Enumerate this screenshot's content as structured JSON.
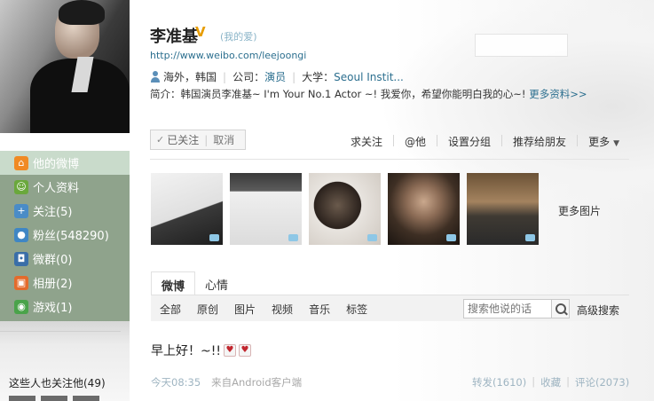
{
  "profile": {
    "name": "李准基",
    "remark": "(我的爱)",
    "url": "http://www.weibo.com/leejoongi",
    "location": "海外，韩国",
    "company_label": "公司：",
    "company": "演员",
    "school_label": "大学：",
    "school": "Seoul Instit...",
    "bio": "简介：韩国演员李准基~ I'm Your No.1 Actor ~! 我爱你，希望你能明白我的心~!",
    "more_info": "更多资料>>"
  },
  "follow": {
    "status": "已关注",
    "cancel": "取消"
  },
  "actions": {
    "ask_follow": "求关注",
    "mention": "@他",
    "set_group": "设置分组",
    "recommend": "推荐给朋友",
    "more": "更多"
  },
  "sidebar": {
    "items": [
      {
        "label": "他的微博",
        "icon": "home-icon",
        "color": "#f08a24"
      },
      {
        "label": "个人资料",
        "icon": "profile-icon",
        "color": "#6aa83c"
      },
      {
        "label": "关注(5)",
        "icon": "follow-icon",
        "color": "#4a8cc7"
      },
      {
        "label": "粉丝(548290)",
        "icon": "fans-icon",
        "color": "#3f86c4"
      },
      {
        "label": "微群(0)",
        "icon": "group-icon",
        "color": "#3a6ea8"
      },
      {
        "label": "相册(2)",
        "icon": "album-icon",
        "color": "#e36b2c"
      },
      {
        "label": "游戏(1)",
        "icon": "game-icon",
        "color": "#4aa34a"
      }
    ],
    "following_title": "这些人也关注他(49)"
  },
  "photos": {
    "more": "更多图片"
  },
  "tabs": [
    "微博",
    "心情"
  ],
  "filters": [
    "全部",
    "原创",
    "图片",
    "视频",
    "音乐",
    "标签"
  ],
  "search": {
    "placeholder": "搜索他说的话",
    "advanced": "高级搜索"
  },
  "post": {
    "text": "早上好！~!!",
    "time": "今天08:35",
    "source": "来自Android客户端",
    "repost": "转发(1610)",
    "favorite": "收藏",
    "comment": "评论(2073)"
  }
}
